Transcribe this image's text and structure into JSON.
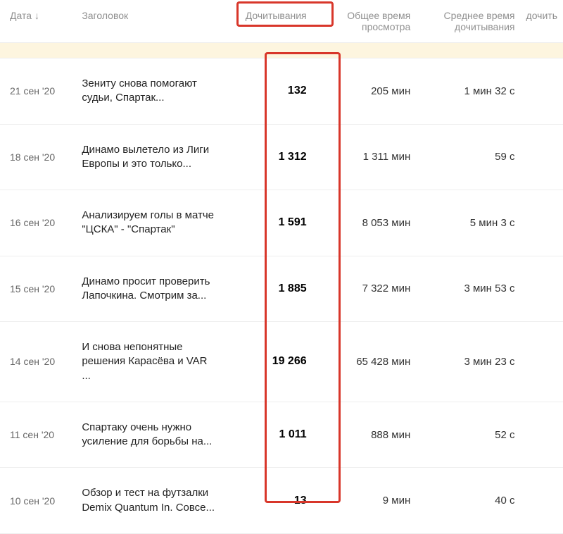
{
  "header": {
    "date": "Дата",
    "title": "Заголовок",
    "reads": "Дочитывания",
    "total_time": "Общее время просмотра",
    "avg_time": "Среднее время дочитывания",
    "extra": "дочить"
  },
  "rows": [
    {
      "date": "21 сен '20",
      "title": "Зениту снова помогают судьи, Спартак...",
      "reads": "132",
      "total": "205 мин",
      "avg": "1 мин 32 с"
    },
    {
      "date": "18 сен '20",
      "title": "Динамо вылетело из Лиги Европы и это только...",
      "reads": "1 312",
      "total": "1 311 мин",
      "avg": "59 с"
    },
    {
      "date": "16 сен '20",
      "title": "Анализируем голы в матче \"ЦСКА\" - \"Спартак\"",
      "reads": "1 591",
      "total": "8 053 мин",
      "avg": "5 мин 3 с"
    },
    {
      "date": "15 сен '20",
      "title": "Динамо просит проверить Лапочкина. Смотрим за...",
      "reads": "1 885",
      "total": "7 322 мин",
      "avg": "3 мин 53 с"
    },
    {
      "date": "14 сен '20",
      "title": "И снова непонятные решения Карасёва и VAR ...",
      "reads": "19 266",
      "total": "65 428 мин",
      "avg": "3 мин 23 с"
    },
    {
      "date": "11 сен '20",
      "title": "Спартаку очень нужно усиление для борьбы на...",
      "reads": "1 011",
      "total": "888 мин",
      "avg": "52 с"
    },
    {
      "date": "10 сен '20",
      "title": "Обзор и тест на футзалки Demix Quantum In. Совсе...",
      "reads": "13",
      "total": "9 мин",
      "avg": "40 с"
    }
  ]
}
